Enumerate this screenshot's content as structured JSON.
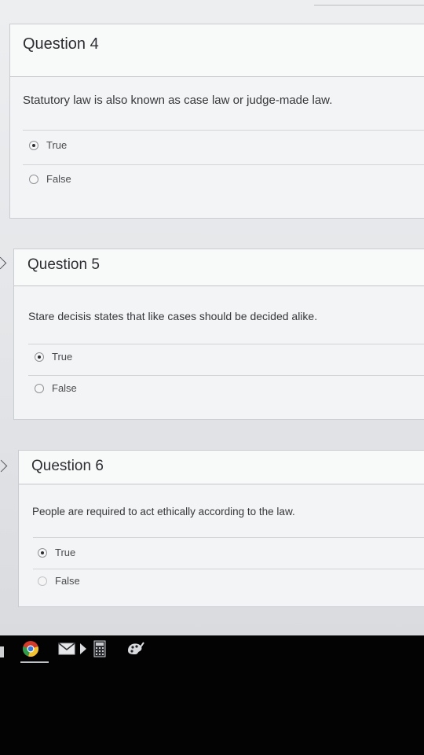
{
  "questions": [
    {
      "title": "Question 4",
      "text": "Statutory law is also known as case law or judge-made law.",
      "options": [
        {
          "label": "True",
          "selected": true
        },
        {
          "label": "False",
          "selected": false
        }
      ]
    },
    {
      "title": "Question 5",
      "text": "Stare decisis states that like cases should be decided alike.",
      "options": [
        {
          "label": "True",
          "selected": true
        },
        {
          "label": "False",
          "selected": false
        }
      ]
    },
    {
      "title": "Question 6",
      "text": "People are required to act ethically according to the law.",
      "options": [
        {
          "label": "True",
          "selected": true
        },
        {
          "label": "False",
          "selected": false
        }
      ]
    }
  ],
  "taskbar": {
    "icons": [
      "chrome-icon",
      "mail-icon",
      "media-icon",
      "calculator-icon",
      "paint-icon"
    ]
  },
  "colors": {
    "page_bg": "#eceef0",
    "card_bg": "#f3f4f5",
    "taskbar_bg": "#030304"
  }
}
